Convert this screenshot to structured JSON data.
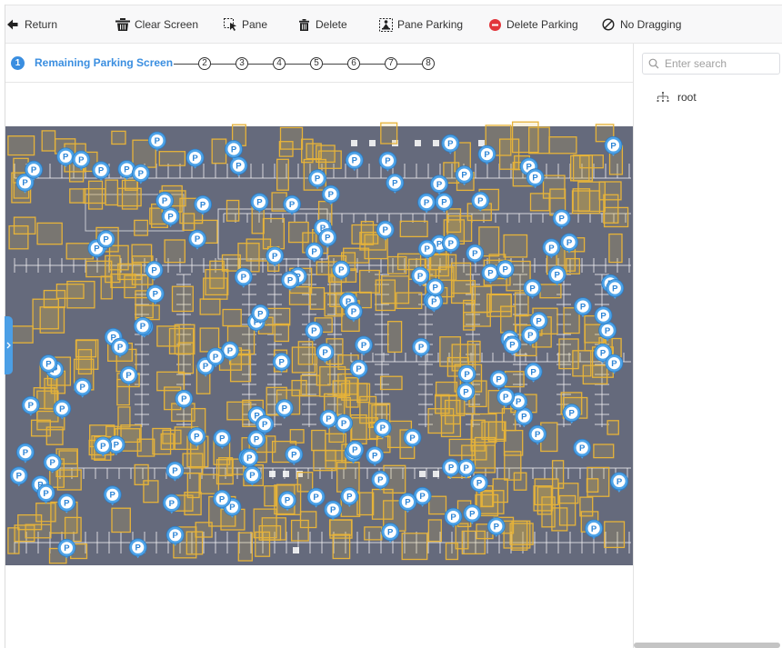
{
  "toolbar": {
    "items": [
      {
        "label": "Return",
        "icon": "arrow-left-icon"
      },
      {
        "label": "Clear Screen",
        "icon": "clear-screen-icon"
      },
      {
        "label": "Pane",
        "icon": "pane-select-icon"
      },
      {
        "label": "Delete",
        "icon": "trash-icon"
      },
      {
        "label": "Pane Parking",
        "icon": "pane-parking-icon"
      },
      {
        "label": "Delete Parking",
        "icon": "delete-parking-icon"
      },
      {
        "label": "No Dragging",
        "icon": "no-dragging-icon"
      }
    ]
  },
  "stepper": {
    "steps": [
      {
        "number": "1",
        "label": "Remaining Parking Screen",
        "state": "active"
      },
      {
        "number": "2",
        "state": "pending"
      },
      {
        "number": "3",
        "state": "pending"
      },
      {
        "number": "4",
        "state": "pending"
      },
      {
        "number": "5",
        "state": "pending"
      },
      {
        "number": "6",
        "state": "pending"
      },
      {
        "number": "7",
        "state": "pending"
      },
      {
        "number": "8",
        "state": "pending"
      }
    ]
  },
  "map": {
    "pin_label": "P",
    "pin_icon": "parking-pin-icon",
    "expand_tab_icon": "chevron-right-icon"
  },
  "sidebar": {
    "search": {
      "placeholder": "Enter search",
      "value": "",
      "icon": "search-icon"
    },
    "tree": [
      {
        "label": "root",
        "icon": "tree-node-icon"
      }
    ]
  },
  "theme": {
    "accent": "#3a8ee0",
    "danger": "#e2353b",
    "map_background": "#656a7c",
    "parking_pane": "#e6b33a",
    "parking_pin": "#4ea3e8",
    "stall_lines": "#f2f2f2"
  }
}
